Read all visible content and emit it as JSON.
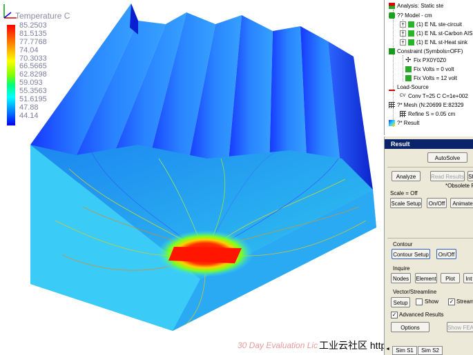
{
  "legend": {
    "title": "Temperature C",
    "values": [
      "85.2503",
      "81.5135",
      "77.7768",
      "74.04",
      "70.3033",
      "66.5665",
      "62.8298",
      "59.093",
      "55.3563",
      "51.6195",
      "47.88",
      "44.14"
    ]
  },
  "watermark": "30 Day Evaluation Lic",
  "footer_site": "工业云社区  http://top.caxa.com/",
  "tree": {
    "analysis": "Analysis: Static ste",
    "model": "?? Model - cm",
    "model_items": [
      "(1)   E NL ste-circuit",
      "(1)   E NL st-Carbon AIS",
      "(1)   E NL st-Heat sink"
    ],
    "constraint": "Constraint (Symbols=OFF)",
    "constraint_items": [
      "Fix PX0Y0Z0",
      "Fix Volts = 0 volt",
      "Fix Volts = 12 volt"
    ],
    "load_source": "Load-Source",
    "load_items": [
      "Conv T=25 C C=1e+002"
    ],
    "mesh": "?* Mesh (N:20699 E:82329",
    "mesh_items": [
      "Refine S = 0.05 cm"
    ],
    "result": "?* Result"
  },
  "panel": {
    "title": "Result",
    "autosolve": "AutoSolve",
    "analyze": "Analyze",
    "read_results": "Read Results",
    "sh": "Sh",
    "obsolete": "*Obsolete R",
    "scale_status": "Scale = Off",
    "scale_setup": "Scale Setup",
    "on_off": "On/Off",
    "animate": "Animate",
    "contour_label": "Contour",
    "contour_setup": "Contour Setup",
    "contour_onoff": "On/Off",
    "inquire_label": "Inquire",
    "nodes": "Nodes",
    "element": "Element",
    "plot": "Plot",
    "int": "Int",
    "vector_label": "Vector/Streamline",
    "setup": "Setup",
    "show": "Show",
    "stream": "Stream",
    "advanced": "Advanced Results",
    "options": "Options",
    "show_fea": "Show FEA",
    "tabs": [
      "Sim S1",
      "Sim S2"
    ],
    "tab_arrow_left": "◄"
  }
}
